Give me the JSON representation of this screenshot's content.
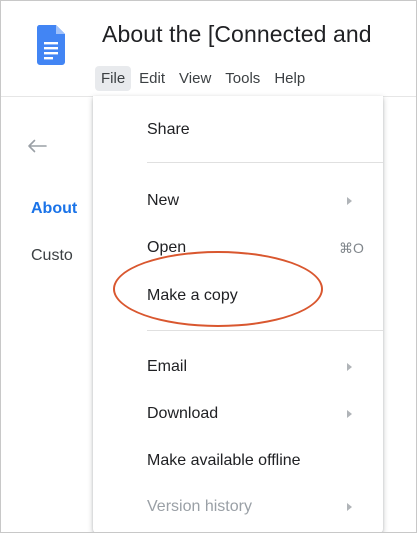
{
  "app": {
    "icon": "google-docs-icon",
    "accent_color": "#4285f4"
  },
  "document": {
    "title": "About the [Connected and"
  },
  "menubar": {
    "items": [
      "File",
      "Edit",
      "View",
      "Tools",
      "Help"
    ],
    "active": "File"
  },
  "outline": {
    "back_icon": "arrow-left-icon",
    "items": [
      {
        "label": "About",
        "current": true
      },
      {
        "label": "Custo",
        "current": false
      }
    ],
    "current_color": "#1a73e8"
  },
  "file_menu": {
    "share": "Share",
    "new": "New",
    "open": "Open",
    "open_shortcut": "⌘O",
    "make_copy": "Make a copy",
    "email": "Email",
    "download": "Download",
    "make_offline": "Make available offline",
    "version_history": "Version history"
  },
  "annotation": {
    "highlight_color": "#d9572f",
    "highlighted_item": "Make a copy"
  }
}
